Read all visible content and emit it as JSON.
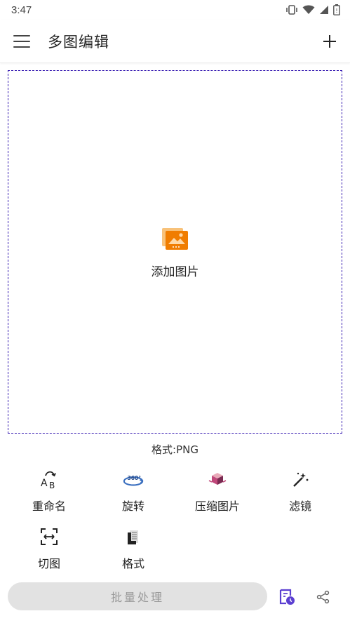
{
  "status_bar": {
    "time": "3:47",
    "icons": [
      "vibrate-icon",
      "wifi-icon",
      "signal-icon",
      "battery-icon"
    ]
  },
  "app_bar": {
    "title": "多图编辑",
    "menu_icon": "hamburger-menu-icon",
    "add_icon": "plus-icon"
  },
  "drop_area": {
    "icon": "add-image-icon",
    "label": "添加图片",
    "border_color": "#3b1fb3"
  },
  "format_line": "格式:PNG",
  "tools": [
    {
      "label": "重命名",
      "icon": "rename-ab-icon"
    },
    {
      "label": "旋转",
      "icon": "rotate-360-icon"
    },
    {
      "label": "压缩图片",
      "icon": "compress-cube-icon"
    },
    {
      "label": "滤镜",
      "icon": "magic-wand-icon"
    },
    {
      "label": "切图",
      "icon": "crop-split-icon"
    },
    {
      "label": "格式",
      "icon": "format-document-icon"
    }
  ],
  "bottom_bar": {
    "batch_label": "批量处理",
    "history_icon": "history-clock-icon",
    "share_icon": "share-icon"
  },
  "colors": {
    "accent": "#5b3fd1",
    "image_icon_orange": "#f5a623",
    "image_icon_dark_orange": "#f07d00",
    "batch_button_bg": "#e2e2e2"
  }
}
